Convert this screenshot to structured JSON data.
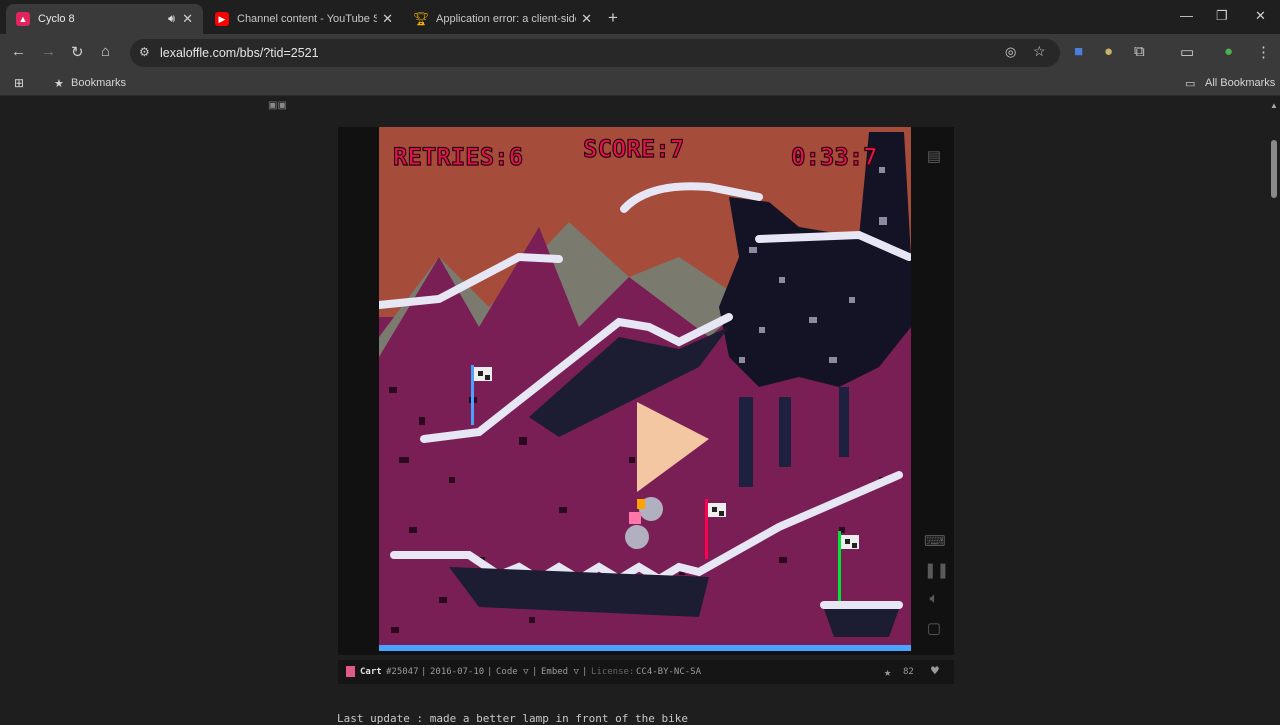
{
  "tabs": [
    {
      "title": "Cyclo 8",
      "favicon_color": "#e0245e",
      "audio": "speaker-icon"
    },
    {
      "title": "Channel content - YouTube Stu",
      "favicon_color": "#ff0000"
    },
    {
      "title": "Application error: a client-side e",
      "favicon_color": "#f5b400"
    }
  ],
  "address": {
    "url": "lexaloffle.com/bbs/?tid=2521"
  },
  "bookmarks": {
    "label": "Bookmarks",
    "all_label": "All Bookmarks"
  },
  "game": {
    "hud_retries": "RETRIES:6",
    "hud_score": "SCORE:7",
    "hud_time": "0:33:7"
  },
  "cart": {
    "type": "Cart",
    "id": "#25047",
    "date": "2016-07-10",
    "code": "Code ▽",
    "embed": "Embed ▽",
    "license_label": "License:",
    "license": "CC4-BY-NC-SA",
    "stars": "82"
  },
  "page": {
    "text": "Last update : made a better lamp in front of the bike"
  },
  "colors": {
    "sky": "#a64c3a",
    "ground": "#7a1f55",
    "snow": "#d8d8ee",
    "hud": "#e0154a"
  }
}
